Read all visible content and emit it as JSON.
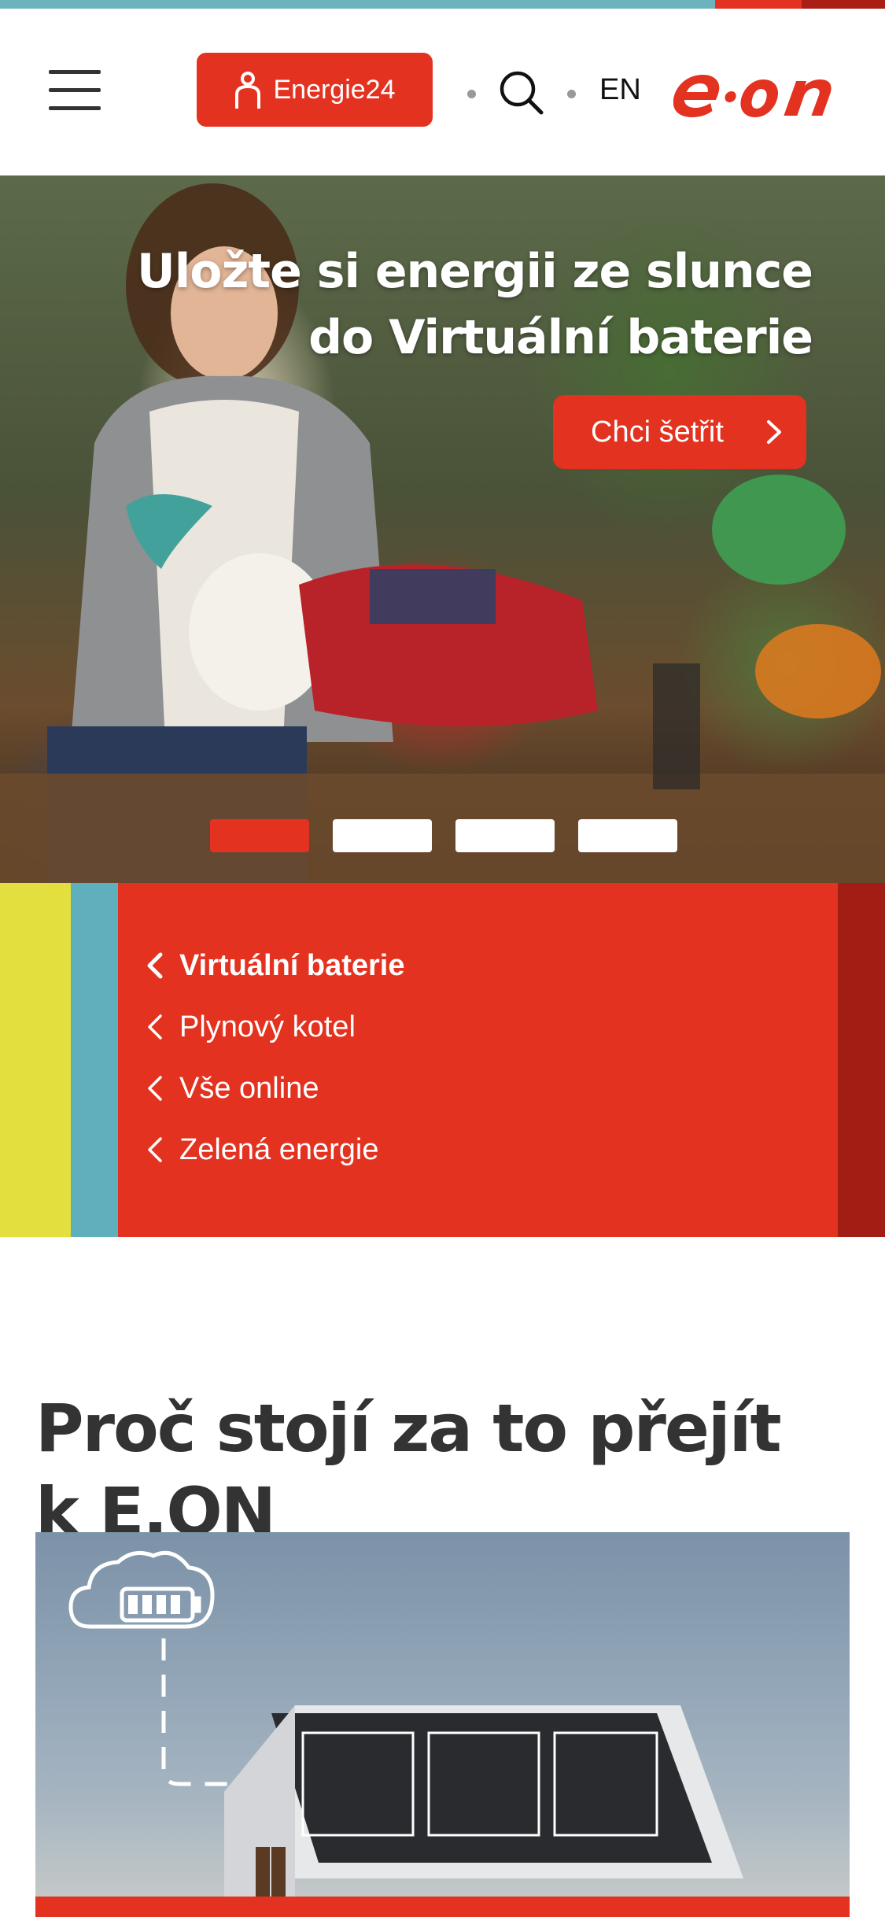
{
  "header": {
    "energie_button_label": "Energie24",
    "language_label": "EN",
    "logo_text": "e·on"
  },
  "hero": {
    "title_line1": "Uložte si energii ze slunce",
    "title_line2": "do Virtuální baterie",
    "cta_label": "Chci šetřit",
    "slide_count": 4,
    "active_slide": 1
  },
  "menu": {
    "items": [
      {
        "label": "Virtuální baterie",
        "active": true
      },
      {
        "label": "Plynový kotel",
        "active": false
      },
      {
        "label": "Vše online",
        "active": false
      },
      {
        "label": "Zelená energie",
        "active": false
      }
    ]
  },
  "section": {
    "title": "Proč stojí za to přejít k E.ON"
  },
  "colors": {
    "brand_red": "#e3321f",
    "dark_red": "#a21e15",
    "teal": "#5fb0bc",
    "yellow": "#e2df3e"
  }
}
